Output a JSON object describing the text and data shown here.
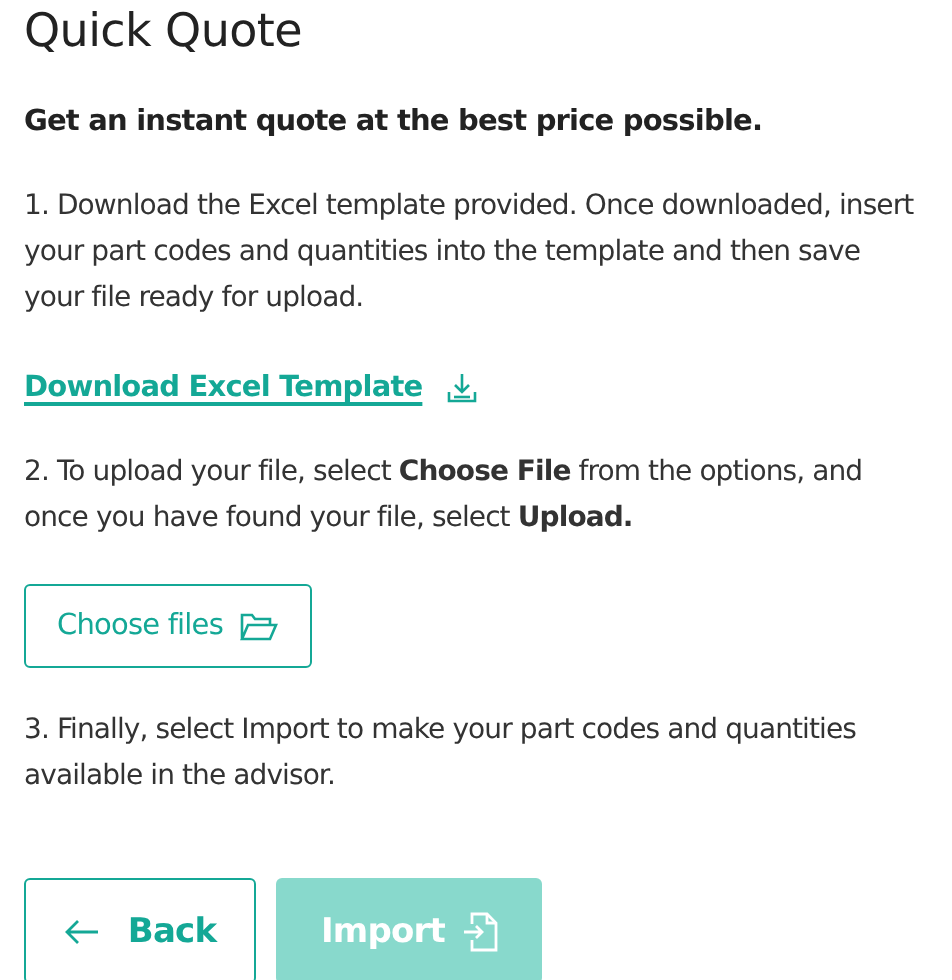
{
  "title": "Quick Quote",
  "subtitle": "Get an instant quote at the best price possible.",
  "step_1": "1. Download the Excel template provided. Once downloaded, insert your part codes and quantities into the template and then save your file ready for upload.",
  "download_link": "Download Excel Template",
  "step_2": "2. To upload your file, select **Choose File** from the options, and once you have found your file, select **Upload.**",
  "choose_button": "Choose files",
  "step_3": "3. Finally, select Import to make your part codes and quantities available in the advisor.",
  "buttons": [
    {
      "kind": "back",
      "label": "Back",
      "disabled": false
    },
    {
      "kind": "import",
      "label": "Import",
      "disabled": true
    }
  ]
}
